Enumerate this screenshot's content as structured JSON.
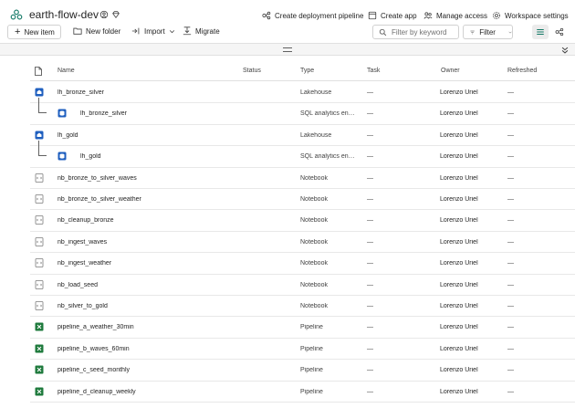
{
  "workspace": {
    "name": "earth-flow-dev",
    "actions": [
      {
        "label": "Create deployment pipeline",
        "icon": "deployment-pipeline-icon"
      },
      {
        "label": "Create app",
        "icon": "app-icon"
      },
      {
        "label": "Manage access",
        "icon": "people-icon"
      },
      {
        "label": "Workspace settings",
        "icon": "gear-icon"
      }
    ]
  },
  "toolbar": {
    "new_item": "New item",
    "new_folder": "New folder",
    "import": "Import",
    "migrate": "Migrate",
    "search_placeholder": "Filter by keyword",
    "filter": "Filter"
  },
  "table": {
    "headers": {
      "name": "Name",
      "status": "Status",
      "type": "Type",
      "task": "Task",
      "owner": "Owner",
      "refreshed": "Refreshed"
    },
    "rows": [
      {
        "name": "lh_bronze_silver",
        "type": "Lakehouse",
        "task": "—",
        "owner": "Lorenzo Uriel",
        "refreshed": "—",
        "icon": "lakehouse",
        "child": false
      },
      {
        "name": "lh_bronze_silver",
        "type": "SQL analytics endpoint",
        "task": "—",
        "owner": "Lorenzo Uriel",
        "refreshed": "—",
        "icon": "sql-endpoint",
        "child": true
      },
      {
        "name": "lh_gold",
        "type": "Lakehouse",
        "task": "—",
        "owner": "Lorenzo Uriel",
        "refreshed": "—",
        "icon": "lakehouse",
        "child": false
      },
      {
        "name": "lh_gold",
        "type": "SQL analytics endpoint",
        "task": "—",
        "owner": "Lorenzo Uriel",
        "refreshed": "—",
        "icon": "sql-endpoint",
        "child": true
      },
      {
        "name": "nb_bronze_to_silver_waves",
        "type": "Notebook",
        "task": "—",
        "owner": "Lorenzo Uriel",
        "refreshed": "—",
        "icon": "notebook",
        "child": false
      },
      {
        "name": "nb_bronze_to_silver_weather",
        "type": "Notebook",
        "task": "—",
        "owner": "Lorenzo Uriel",
        "refreshed": "—",
        "icon": "notebook",
        "child": false
      },
      {
        "name": "nb_cleanup_bronze",
        "type": "Notebook",
        "task": "—",
        "owner": "Lorenzo Uriel",
        "refreshed": "—",
        "icon": "notebook",
        "child": false
      },
      {
        "name": "nb_ingest_waves",
        "type": "Notebook",
        "task": "—",
        "owner": "Lorenzo Uriel",
        "refreshed": "—",
        "icon": "notebook",
        "child": false
      },
      {
        "name": "nb_ingest_weather",
        "type": "Notebook",
        "task": "—",
        "owner": "Lorenzo Uriel",
        "refreshed": "—",
        "icon": "notebook",
        "child": false
      },
      {
        "name": "nb_load_seed",
        "type": "Notebook",
        "task": "—",
        "owner": "Lorenzo Uriel",
        "refreshed": "—",
        "icon": "notebook",
        "child": false
      },
      {
        "name": "nb_silver_to_gold",
        "type": "Notebook",
        "task": "—",
        "owner": "Lorenzo Uriel",
        "refreshed": "—",
        "icon": "notebook",
        "child": false
      },
      {
        "name": "pipeline_a_weather_30min",
        "type": "Pipeline",
        "task": "—",
        "owner": "Lorenzo Uriel",
        "refreshed": "—",
        "icon": "pipeline",
        "child": false
      },
      {
        "name": "pipeline_b_waves_60min",
        "type": "Pipeline",
        "task": "—",
        "owner": "Lorenzo Uriel",
        "refreshed": "—",
        "icon": "pipeline",
        "child": false
      },
      {
        "name": "pipeline_c_seed_monthly",
        "type": "Pipeline",
        "task": "—",
        "owner": "Lorenzo Uriel",
        "refreshed": "—",
        "icon": "pipeline",
        "child": false
      },
      {
        "name": "pipeline_d_cleanup_weekly",
        "type": "Pipeline",
        "task": "—",
        "owner": "Lorenzo Uriel",
        "refreshed": "—",
        "icon": "pipeline",
        "child": false
      }
    ]
  },
  "colors": {
    "lakehouse": "#1f5fbf",
    "notebook": "#7a7a7a",
    "pipeline": "#1e7a3c",
    "brand": "#117865"
  }
}
